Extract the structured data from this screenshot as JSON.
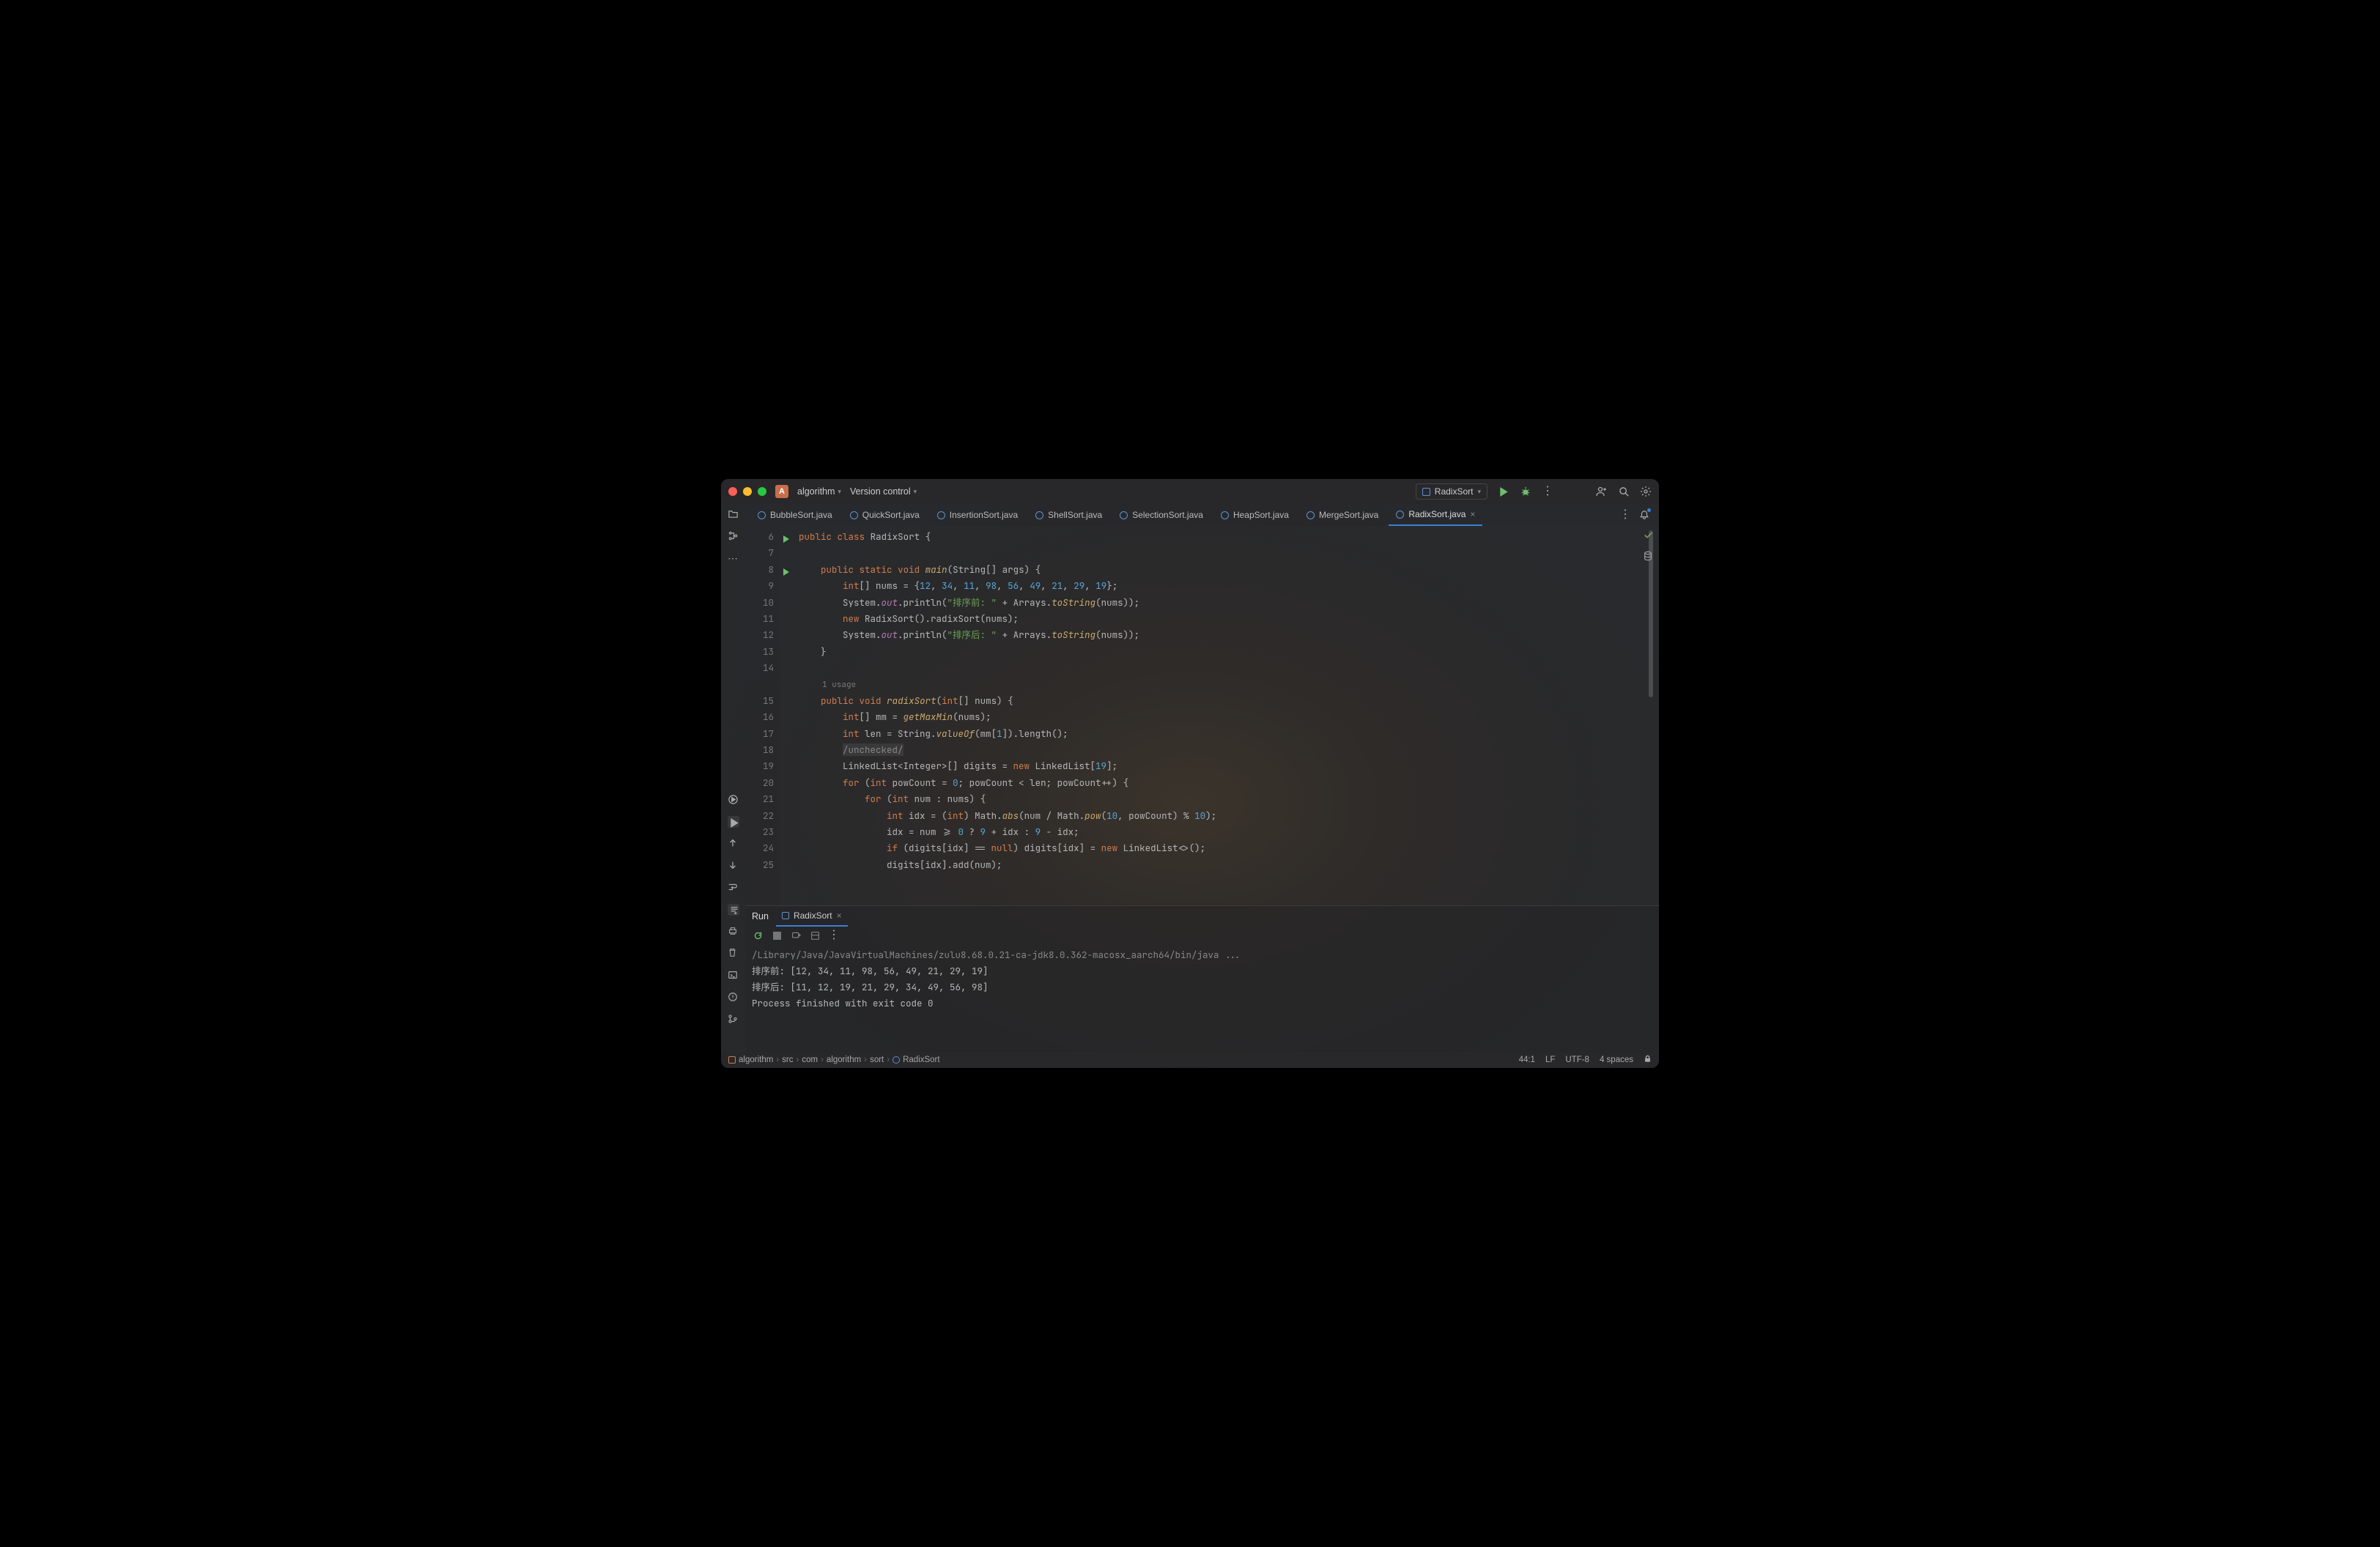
{
  "titlebar": {
    "project_letter": "A",
    "project_name": "algorithm",
    "version_control": "Version control"
  },
  "run_config": {
    "name": "RadixSort"
  },
  "tabs": [
    {
      "name": "BubbleSort.java",
      "active": false
    },
    {
      "name": "QuickSort.java",
      "active": false
    },
    {
      "name": "InsertionSort.java",
      "active": false
    },
    {
      "name": "ShellSort.java",
      "active": false
    },
    {
      "name": "SelectionSort.java",
      "active": false
    },
    {
      "name": "HeapSort.java",
      "active": false
    },
    {
      "name": "MergeSort.java",
      "active": false
    },
    {
      "name": "RadixSort.java",
      "active": true
    }
  ],
  "gutter_start": 6,
  "gutter_end": 25,
  "usage_hint": "1 usage",
  "code_tokens": {
    "l6": [
      [
        "kw",
        "public"
      ],
      [
        "pun",
        " "
      ],
      [
        "kw",
        "class"
      ],
      [
        "pun",
        " "
      ],
      [
        "cls",
        "RadixSort"
      ],
      [
        "pun",
        " {"
      ]
    ],
    "l7": [],
    "l8": [
      [
        "pun",
        "    "
      ],
      [
        "kw",
        "public"
      ],
      [
        "pun",
        " "
      ],
      [
        "kw",
        "static"
      ],
      [
        "pun",
        " "
      ],
      [
        "kw",
        "void"
      ],
      [
        "pun",
        " "
      ],
      [
        "fn2",
        "main"
      ],
      [
        "pun",
        "(String[] args) {"
      ]
    ],
    "l9": [
      [
        "pun",
        "        "
      ],
      [
        "type",
        "int"
      ],
      [
        "pun",
        "[] nums = {"
      ],
      [
        "num",
        "12"
      ],
      [
        "pun",
        ", "
      ],
      [
        "num",
        "34"
      ],
      [
        "pun",
        ", "
      ],
      [
        "num",
        "11"
      ],
      [
        "pun",
        ", "
      ],
      [
        "num",
        "98"
      ],
      [
        "pun",
        ", "
      ],
      [
        "num",
        "56"
      ],
      [
        "pun",
        ", "
      ],
      [
        "num",
        "49"
      ],
      [
        "pun",
        ", "
      ],
      [
        "num",
        "21"
      ],
      [
        "pun",
        ", "
      ],
      [
        "num",
        "29"
      ],
      [
        "pun",
        ", "
      ],
      [
        "num",
        "19"
      ],
      [
        "pun",
        "};"
      ]
    ],
    "l10": [
      [
        "pun",
        "        System."
      ],
      [
        "field",
        "out"
      ],
      [
        "pun",
        ".println("
      ],
      [
        "str",
        "\"排序前: \""
      ],
      [
        "pun",
        " + Arrays."
      ],
      [
        "fn2",
        "toString"
      ],
      [
        "pun",
        "(nums));"
      ]
    ],
    "l11": [
      [
        "pun",
        "        "
      ],
      [
        "kw",
        "new"
      ],
      [
        "pun",
        " RadixSort().radixSort(nums);"
      ]
    ],
    "l12": [
      [
        "pun",
        "        System."
      ],
      [
        "field",
        "out"
      ],
      [
        "pun",
        ".println("
      ],
      [
        "str",
        "\"排序后: \""
      ],
      [
        "pun",
        " + Arrays."
      ],
      [
        "fn2",
        "toString"
      ],
      [
        "pun",
        "(nums));"
      ]
    ],
    "l13": [
      [
        "pun",
        "    }"
      ]
    ],
    "l14": [],
    "l15": [
      [
        "pun",
        "    "
      ],
      [
        "kw",
        "public"
      ],
      [
        "pun",
        " "
      ],
      [
        "kw",
        "void"
      ],
      [
        "pun",
        " "
      ],
      [
        "fn2",
        "radixSort"
      ],
      [
        "pun",
        "("
      ],
      [
        "type",
        "int"
      ],
      [
        "pun",
        "[] nums) {"
      ]
    ],
    "l16": [
      [
        "pun",
        "        "
      ],
      [
        "type",
        "int"
      ],
      [
        "pun",
        "[] mm = "
      ],
      [
        "fn2",
        "getMaxMin"
      ],
      [
        "pun",
        "(nums);"
      ]
    ],
    "l17": [
      [
        "pun",
        "        "
      ],
      [
        "type",
        "int"
      ],
      [
        "pun",
        " len = String."
      ],
      [
        "fn2",
        "valueOf"
      ],
      [
        "pun",
        "(mm["
      ],
      [
        "num",
        "1"
      ],
      [
        "pun",
        "]).length();"
      ]
    ],
    "l18": [
      [
        "pun",
        "        "
      ],
      [
        "comment-block",
        "/unchecked/"
      ]
    ],
    "l19": [
      [
        "pun",
        "        LinkedList<Integer>[] digits = "
      ],
      [
        "kw",
        "new"
      ],
      [
        "pun",
        " LinkedList["
      ],
      [
        "num",
        "19"
      ],
      [
        "pun",
        "];"
      ]
    ],
    "l20": [
      [
        "pun",
        "        "
      ],
      [
        "kw",
        "for"
      ],
      [
        "pun",
        " ("
      ],
      [
        "type",
        "int"
      ],
      [
        "pun",
        " "
      ],
      [
        "var",
        "powCount"
      ],
      [
        "pun",
        " = "
      ],
      [
        "num",
        "0"
      ],
      [
        "pun",
        "; powCount < len; "
      ],
      [
        "var",
        "powCount++"
      ],
      [
        "pun",
        ") {"
      ]
    ],
    "l21": [
      [
        "pun",
        "            "
      ],
      [
        "kw",
        "for"
      ],
      [
        "pun",
        " ("
      ],
      [
        "type",
        "int"
      ],
      [
        "pun",
        " num : nums) {"
      ]
    ],
    "l22": [
      [
        "pun",
        "                "
      ],
      [
        "type",
        "int"
      ],
      [
        "pun",
        " idx = ("
      ],
      [
        "type",
        "int"
      ],
      [
        "pun",
        ") Math."
      ],
      [
        "fn2",
        "abs"
      ],
      [
        "pun",
        "(num / Math."
      ],
      [
        "fn2",
        "pow"
      ],
      [
        "pun",
        "("
      ],
      [
        "num",
        "10"
      ],
      [
        "pun",
        ", powCount) % "
      ],
      [
        "num",
        "10"
      ],
      [
        "pun",
        ");"
      ]
    ],
    "l23": [
      [
        "pun",
        "                idx = num >= "
      ],
      [
        "num",
        "0"
      ],
      [
        "pun",
        " ? "
      ],
      [
        "num",
        "9"
      ],
      [
        "pun",
        " + idx : "
      ],
      [
        "num",
        "9"
      ],
      [
        "pun",
        " - idx;"
      ]
    ],
    "l24": [
      [
        "pun",
        "                "
      ],
      [
        "kw",
        "if"
      ],
      [
        "pun",
        " (digits[idx] == "
      ],
      [
        "kw",
        "null"
      ],
      [
        "pun",
        ") digits[idx] = "
      ],
      [
        "kw",
        "new"
      ],
      [
        "pun",
        " LinkedList<>();"
      ]
    ],
    "l25": [
      [
        "pun",
        "                digits[idx].add(num);"
      ]
    ]
  },
  "run_panel": {
    "label": "Run",
    "config": "RadixSort",
    "console": [
      {
        "cls": "console-path",
        "text": "/Library/Java/JavaVirtualMachines/zulu8.68.0.21-ca-jdk8.0.362-macosx_aarch64/bin/java ..."
      },
      {
        "cls": "",
        "text": "排序前: [12, 34, 11, 98, 56, 49, 21, 29, 19]"
      },
      {
        "cls": "",
        "text": "排序后: [11, 12, 19, 21, 29, 34, 49, 56, 98]"
      },
      {
        "cls": "",
        "text": ""
      },
      {
        "cls": "",
        "text": "Process finished with exit code 0"
      }
    ]
  },
  "breadcrumb": [
    "algorithm",
    "src",
    "com",
    "algorithm",
    "sort",
    "RadixSort"
  ],
  "status": {
    "position": "44:1",
    "line_sep": "LF",
    "encoding": "UTF-8",
    "indent": "4 spaces"
  }
}
